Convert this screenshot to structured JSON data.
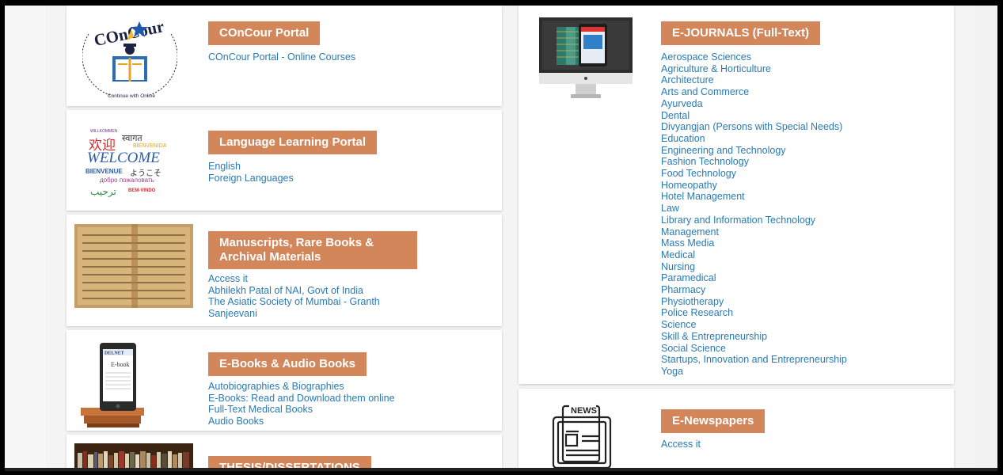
{
  "sections": {
    "concour": {
      "title": "COnCour Portal",
      "links": [
        "COnCour Portal - Online Courses"
      ]
    },
    "language": {
      "title": "Language Learning Portal",
      "links": [
        "English",
        "Foreign Languages"
      ]
    },
    "manuscripts": {
      "title_line1": "Manuscripts, Rare Books &",
      "title_line2": "Archival Materials",
      "links": [
        "Access it",
        "Abhilekh Patal of NAI, Govt of India",
        "The Asiatic Society of Mumbai - Granth",
        "Sanjeevani"
      ]
    },
    "ebooks": {
      "title": "E-Books & Audio Books",
      "links": [
        "Autobiographies & Biographies",
        "E-Books: Read and Download them online",
        "Full-Text Medical Books",
        "Audio Books"
      ]
    },
    "thesis": {
      "title": "THESIS/DISSERTATIONS"
    },
    "ejournals": {
      "title": "E-JOURNALS (Full-Text)",
      "links": [
        "Aerospace Sciences",
        "Agriculture & Horticulture",
        "Architecture",
        "Arts and Commerce",
        "Ayurveda",
        "Dental",
        "Divyangjan (Persons with Special Needs)",
        "Education",
        "Engineering and Technology",
        "Fashion Technology",
        "Food Technology",
        "Homeopathy",
        "Hotel Management",
        "Law",
        "Library and Information Technology",
        "Management",
        "Mass Media",
        "Medical",
        "Nursing",
        "Paramedical",
        "Pharmacy",
        "Physiotherapy",
        "Police Research",
        "Science",
        "Skill & Entrepreneurship",
        "Social Science",
        "Startups, Innovation and Entrepreneurship",
        "Yoga"
      ]
    },
    "enews": {
      "title": "E-Newspapers",
      "links": [
        "Access it"
      ]
    }
  },
  "logos": {
    "concour_word": "COnCour",
    "concour_tagline": "Continue with Online Courses to Conquer your Future Now",
    "welcome_words": [
      "WILLKOMMEN",
      "स्वागत",
      "欢迎",
      "BIENVENIDA",
      "WELCOME",
      "BIENVENUE",
      "ようこそ",
      "добро пожаловать",
      "ترحيب",
      "BEM-VINDO"
    ],
    "delnet": "DELNET",
    "ebook": "E-book",
    "news": "NEWS"
  },
  "colors": {
    "header_bg": "#d3865a",
    "link": "#2a7ab0"
  }
}
